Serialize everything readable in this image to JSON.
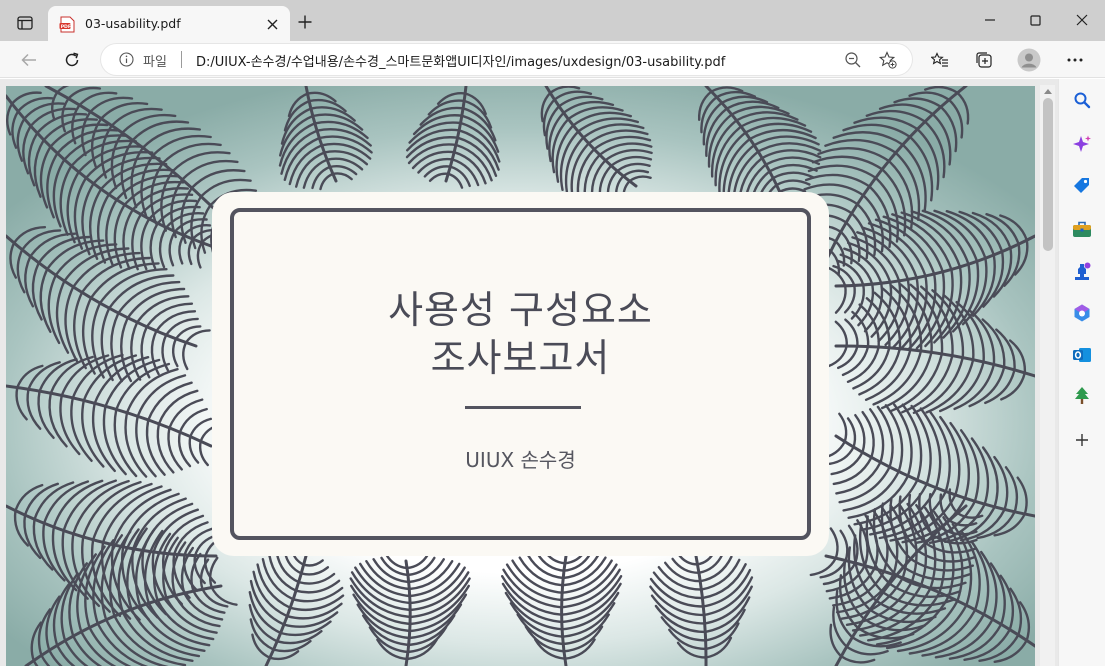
{
  "browser": {
    "tab": {
      "title": "03-usability.pdf",
      "icon": "pdf-file-icon"
    },
    "address": {
      "scheme_label": "파일",
      "url": "D:/UIUX-손수경/수업내용/손수경_스마트문화앱UI디자인/images/uxdesign/03-usability.pdf"
    },
    "toolbar_icons": [
      "back-arrow-icon",
      "refresh-icon",
      "info-icon",
      "zoom-out-icon",
      "add-favorite-icon",
      "favorites-icon",
      "collections-icon",
      "profile-icon",
      "more-icon"
    ],
    "sidebar_icons": [
      "search-icon",
      "copilot-icon",
      "shopping-tag-icon",
      "toolbox-icon",
      "games-icon",
      "microsoft-365-icon",
      "outlook-icon",
      "tree-icon",
      "add-icon"
    ]
  },
  "document": {
    "title_line1": "사용성 구성요소",
    "title_line2": "조사보고서",
    "author": "UIUX 손수경"
  },
  "colors": {
    "accent_dark": "#4a4b57",
    "card_background": "#fbf9f4",
    "page_edge_tint": "#8aaca7"
  }
}
